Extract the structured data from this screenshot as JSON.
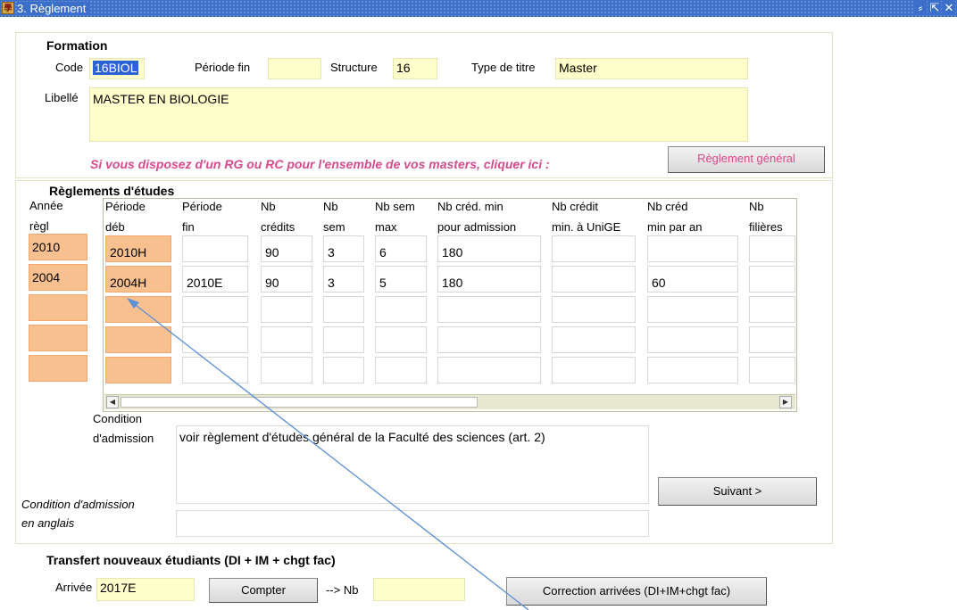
{
  "window": {
    "title": "3. Règlement",
    "icon_glyph": "學",
    "minimize_glyph": "⸗",
    "maximize_glyph": "⇱",
    "close_glyph": "✕"
  },
  "formation": {
    "heading": "Formation",
    "code_label": "Code",
    "code_value": "16BIOL",
    "periode_fin_label": "Période fin",
    "periode_fin_value": "",
    "structure_label": "Structure",
    "structure_value": "16",
    "type_titre_label": "Type de titre",
    "type_titre_value": "Master",
    "libelle_label": "Libellé",
    "libelle_value": "MASTER EN BIOLOGIE",
    "rg_note": "Si vous disposez d'un RG ou RC pour l'ensemble de vos masters, cliquer ici :",
    "reglement_general_button": "Règlement général"
  },
  "reglements": {
    "heading": "Règlements d'études",
    "annee_header": [
      "Année",
      "règl"
    ],
    "columns": [
      {
        "line1": "Période",
        "line2": "déb"
      },
      {
        "line1": "Période",
        "line2": "fin"
      },
      {
        "line1": "Nb",
        "line2": "crédits"
      },
      {
        "line1": "Nb",
        "line2": "sem"
      },
      {
        "line1": "Nb sem",
        "line2": "max"
      },
      {
        "line1": "Nb créd. min",
        "line2": "pour admission"
      },
      {
        "line1": "Nb crédit",
        "line2": "min. à UniGE"
      },
      {
        "line1": "Nb créd",
        "line2": "min par an"
      },
      {
        "line1": "Nb",
        "line2": "filières"
      }
    ],
    "rows": [
      {
        "annee": "2010",
        "cells": [
          "2010H",
          "",
          "90",
          "3",
          "6",
          "180",
          "",
          "",
          ""
        ]
      },
      {
        "annee": "2004",
        "cells": [
          "2004H",
          "2010E",
          "90",
          "3",
          "5",
          "180",
          "",
          "60",
          ""
        ]
      },
      {
        "annee": "",
        "cells": [
          "",
          "",
          "",
          "",
          "",
          "",
          "",
          "",
          ""
        ]
      },
      {
        "annee": "",
        "cells": [
          "",
          "",
          "",
          "",
          "",
          "",
          "",
          "",
          ""
        ]
      },
      {
        "annee": "",
        "cells": [
          "",
          "",
          "",
          "",
          "",
          "",
          "",
          "",
          ""
        ]
      }
    ],
    "scroll_left_glyph": "◀",
    "scroll_right_glyph": "▶",
    "condition_label_1": "Condition",
    "condition_label_2": "d'admission",
    "condition_value": "voir règlement d'études général de la Faculté des sciences (art. 2)",
    "condition_en_label_1": "Condition d'admission",
    "condition_en_label_2": "en anglais",
    "condition_en_value": "",
    "suivant_button": "Suivant >"
  },
  "transfert": {
    "heading": "Transfert nouveaux étudiants (DI + IM + chgt fac)",
    "arrivee_label": "Arrivée",
    "arrivee_value": "2017E",
    "compter_button": "Compter",
    "nb_label": "--> Nb",
    "nb_value": "",
    "correction_button": "Correction arrivées (DI+IM+chgt fac)"
  },
  "colors": {
    "titlebar": "#3c6fc9",
    "field_yellow": "#ffffcc",
    "key_orange": "#f9c08f",
    "note_pink": "#d94a8c",
    "annotation_arrow": "#5b8fd6"
  }
}
